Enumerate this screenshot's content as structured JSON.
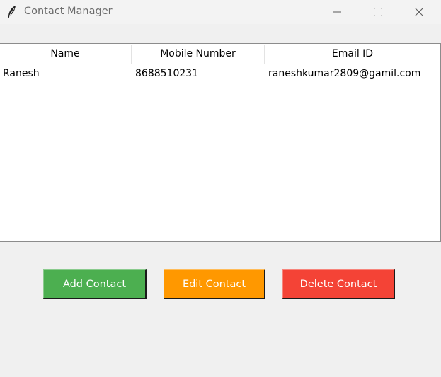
{
  "window": {
    "title": "Contact Manager"
  },
  "table": {
    "columns": [
      "Name",
      "Mobile Number",
      "Email ID"
    ],
    "rows": [
      [
        "Ranesh",
        "8688510231",
        "raneshkumar2809@gamil.com"
      ]
    ]
  },
  "buttons": {
    "add": {
      "label": "Add Contact",
      "color": "#4caf50"
    },
    "edit": {
      "label": "Edit Contact",
      "color": "#ff9800"
    },
    "delete": {
      "label": "Delete Contact",
      "color": "#f44336"
    }
  },
  "icons": {
    "app": "feather-icon",
    "minimize": "minimize-icon",
    "maximize": "maximize-icon",
    "close": "close-icon"
  }
}
